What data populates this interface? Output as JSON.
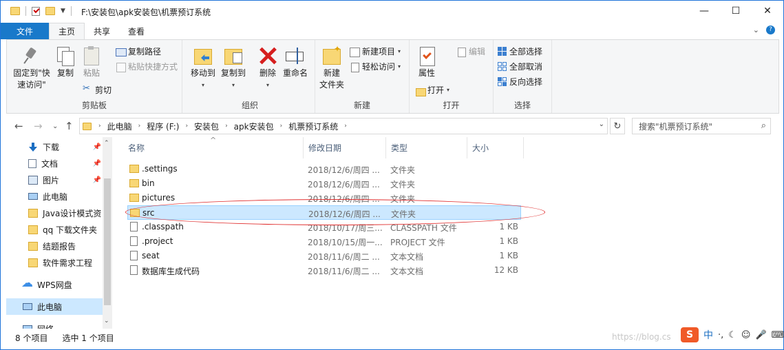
{
  "window": {
    "title": "F:\\安装包\\apk安装包\\机票预订系统",
    "min_glyph": "—",
    "max_glyph": "☐",
    "close_glyph": "✕"
  },
  "tabs": {
    "file": "文件",
    "home": "主页",
    "share": "共享",
    "view": "查看"
  },
  "ribbon": {
    "clipboard": {
      "label": "剪贴板",
      "pin": "固定到\"快速访问\"",
      "copy": "复制",
      "paste": "粘贴",
      "copy_path": "复制路径",
      "paste_shortcut": "粘贴快捷方式",
      "cut": "剪切"
    },
    "organize": {
      "label": "组织",
      "move_to": "移动到",
      "copy_to": "复制到",
      "delete": "删除",
      "rename": "重命名"
    },
    "new": {
      "label": "新建",
      "new_folder": "新建\n文件夹",
      "new_item": "新建项目",
      "easy_access": "轻松访问"
    },
    "open": {
      "label": "打开",
      "properties": "属性",
      "open": "打开",
      "edit": "编辑"
    },
    "select": {
      "label": "选择",
      "select_all": "全部选择",
      "select_none": "全部取消",
      "invert": "反向选择"
    }
  },
  "address": {
    "crumbs": [
      "此电脑",
      "程序 (F:)",
      "安装包",
      "apk安装包",
      "机票预订系统"
    ],
    "search_placeholder": "搜索\"机票预订系统\""
  },
  "nav": {
    "items": [
      {
        "label": "下载",
        "icon": "download-icon",
        "pinned": true
      },
      {
        "label": "文档",
        "icon": "document-icon",
        "pinned": true
      },
      {
        "label": "图片",
        "icon": "pictures-icon",
        "pinned": true
      },
      {
        "label": "此电脑",
        "icon": "computer-icon",
        "pinned": false
      },
      {
        "label": "Java设计模式资",
        "icon": "folder-icon",
        "pinned": false
      },
      {
        "label": "qq 下载文件夹",
        "icon": "folder-icon",
        "pinned": false
      },
      {
        "label": "结题报告",
        "icon": "folder-icon",
        "pinned": false
      },
      {
        "label": "软件需求工程",
        "icon": "folder-icon",
        "pinned": false
      },
      {
        "label": "WPS网盘",
        "icon": "cloud-icon",
        "pinned": false
      },
      {
        "label": "此电脑",
        "icon": "computer-icon",
        "pinned": false
      },
      {
        "label": "网络",
        "icon": "network-icon",
        "pinned": false
      }
    ]
  },
  "columns": {
    "name": "名称",
    "date": "修改日期",
    "type": "类型",
    "size": "大小"
  },
  "files": [
    {
      "name": ".settings",
      "date": "2018/12/6/周四 ...",
      "type": "文件夹",
      "size": "",
      "kind": "folder"
    },
    {
      "name": "bin",
      "date": "2018/12/6/周四 ...",
      "type": "文件夹",
      "size": "",
      "kind": "folder"
    },
    {
      "name": "pictures",
      "date": "2018/12/6/周四 ...",
      "type": "文件夹",
      "size": "",
      "kind": "folder"
    },
    {
      "name": "src",
      "date": "2018/12/6/周四 ...",
      "type": "文件夹",
      "size": "",
      "kind": "folder",
      "selected": true
    },
    {
      "name": ".classpath",
      "date": "2018/10/17/周三...",
      "type": "CLASSPATH 文件",
      "size": "1 KB",
      "kind": "file"
    },
    {
      "name": ".project",
      "date": "2018/10/15/周一...",
      "type": "PROJECT 文件",
      "size": "1 KB",
      "kind": "file"
    },
    {
      "name": "seat",
      "date": "2018/11/6/周二 ...",
      "type": "文本文档",
      "size": "1 KB",
      "kind": "text"
    },
    {
      "name": "数据库生成代码",
      "date": "2018/11/6/周二 ...",
      "type": "文本文档",
      "size": "12 KB",
      "kind": "text"
    }
  ],
  "status": {
    "count": "8 个项目",
    "selected": "选中 1 个项目"
  },
  "watermark": "https://blog.cs",
  "ime": {
    "logo": "S",
    "lang": "中"
  }
}
